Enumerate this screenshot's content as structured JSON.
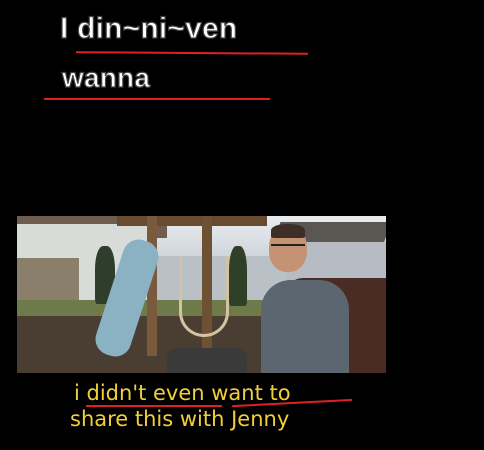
{
  "overlay": {
    "line1": "I din~ni~ven",
    "line2": "wanna"
  },
  "subtitle": {
    "line1": "i didn't even want to",
    "line2": "share this with Jenny"
  },
  "colors": {
    "background": "#000000",
    "underline": "#e02020",
    "subtitle_text": "#f2cf3a",
    "overlay_text": "#ffffff"
  }
}
